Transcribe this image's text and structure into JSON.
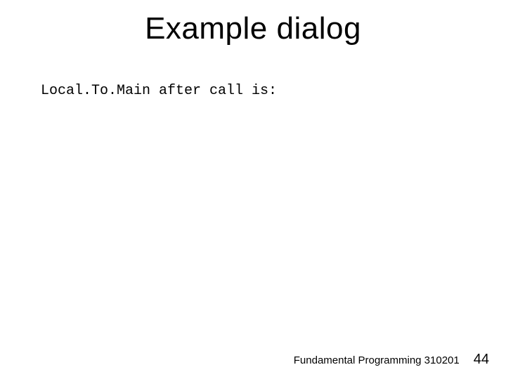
{
  "slide": {
    "title": "Example dialog",
    "body": "Local.To.Main after call is:"
  },
  "footer": {
    "course": "Fundamental Programming 310201",
    "page": "44"
  }
}
